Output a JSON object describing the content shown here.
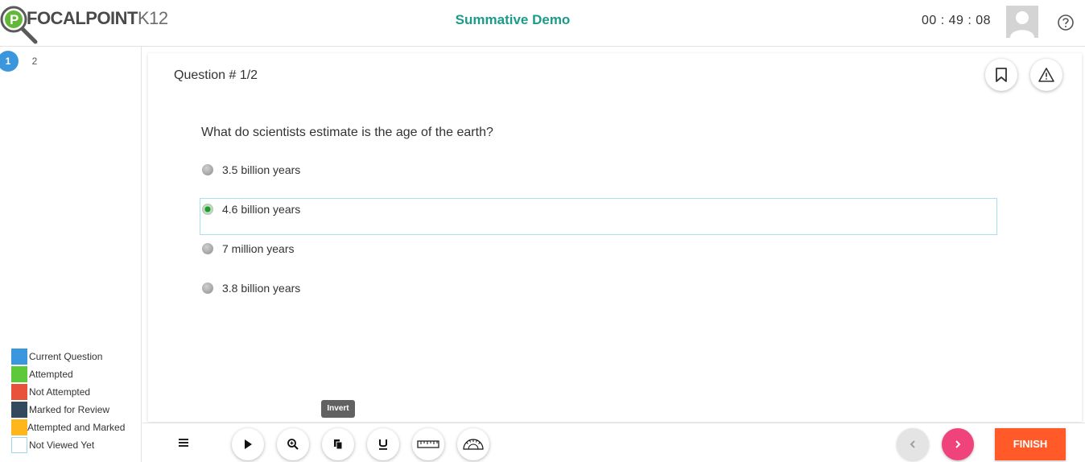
{
  "app": {
    "logo": {
      "main": "FOCALPOINT",
      "suffix": "K12"
    },
    "title": "Summative Demo",
    "timer": "00 : 49 : 08"
  },
  "sidebar": {
    "questions": [
      "1",
      "2"
    ],
    "current_index": 0,
    "legend": [
      {
        "label": "Current Question",
        "color": "#3a97dd"
      },
      {
        "label": "Attempted",
        "color": "#5ec83b"
      },
      {
        "label": "Not Attempted",
        "color": "#e8523d"
      },
      {
        "label": "Marked for Review",
        "color": "#34495e"
      },
      {
        "label": "Attempted and Marked",
        "color": "#ffb61a"
      },
      {
        "label": "Not Viewed Yet",
        "color": "#ffffff"
      }
    ]
  },
  "question": {
    "label": "Question # 1/2",
    "text": "What do scientists estimate is the age of the earth?",
    "options": [
      {
        "text": "3.5 billion years",
        "selected": false
      },
      {
        "text": "4.6 billion years",
        "selected": true
      },
      {
        "text": "7 million years",
        "selected": false
      },
      {
        "text": "3.8 billion years",
        "selected": false
      }
    ]
  },
  "toolbar": {
    "tooltip": "Invert",
    "tools": [
      "menu-icon",
      "play-icon",
      "zoom-in-icon",
      "invert-icon",
      "underline-icon",
      "ruler-icon",
      "protractor-icon"
    ],
    "finish_label": "FINISH"
  },
  "colors": {
    "title": "#1b9b8a",
    "next_button": "#f0437b",
    "finish_button": "#ff5a27",
    "selected_border": "#a7e0ef"
  }
}
